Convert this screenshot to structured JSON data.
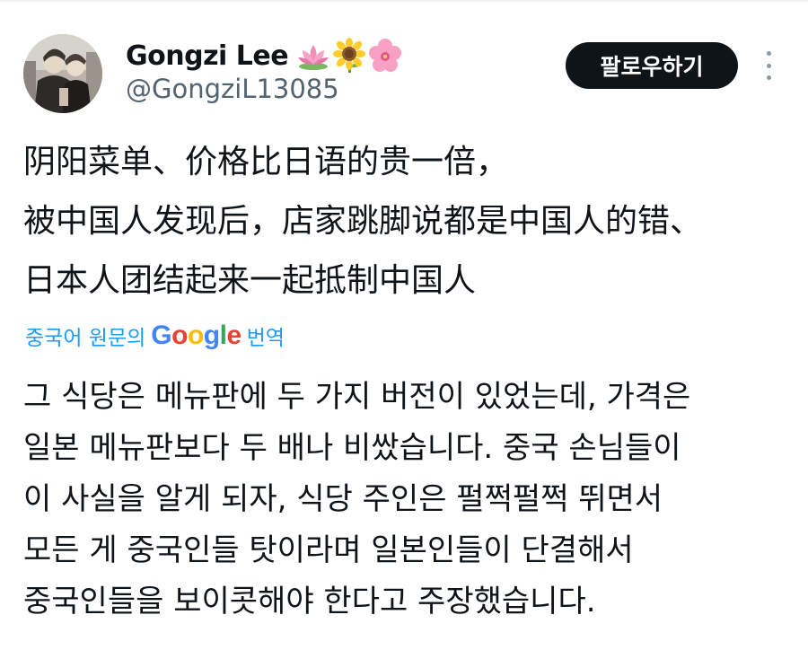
{
  "user": {
    "display_name": "Gongzi Lee",
    "handle": "@GongziL13085",
    "emojis": [
      "lotus-emoji",
      "sunflower-emoji",
      "cherry-blossom-emoji"
    ]
  },
  "actions": {
    "follow_label": "팔로우하기"
  },
  "tweet": {
    "lines": [
      "阴阳菜单、价格比日语的贵一倍，",
      "被中国人发现后，店家跳脚说都是中国人的错、",
      "日本人团结起来一起抵制中国人"
    ]
  },
  "translation": {
    "prefix": "중국어 원문의",
    "google_letters": [
      "G",
      "o",
      "o",
      "g",
      "l",
      "e"
    ],
    "suffix": "번역",
    "lines": [
      "그 식당은 메뉴판에 두 가지 버전이 있었는데, 가격은",
      "일본 메뉴판보다 두 배나 비쌌습니다. 중국 손님들이",
      "이 사실을 알게 되자, 식당 주인은 펄쩍펄쩍 뛰면서",
      "모든 게 중국인들 탓이라며 일본인들이 단결해서",
      "중국인들을 보이콧해야 한다고 주장했습니다."
    ]
  },
  "colors": {
    "text": "#0f1419",
    "secondary": "#536471",
    "link": "#1d9bf0",
    "button_bg": "#0f1419"
  }
}
